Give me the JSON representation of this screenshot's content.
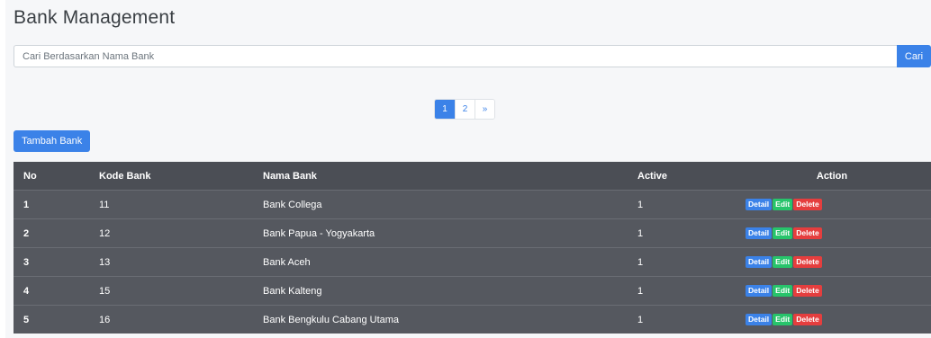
{
  "header": {
    "title": "Bank Management"
  },
  "search": {
    "placeholder": "Cari Berdasarkan Nama Bank",
    "value": "",
    "button_label": "Cari"
  },
  "pagination": {
    "pages": [
      "1",
      "2"
    ],
    "next_label": "»",
    "active_page": "1"
  },
  "toolbar": {
    "add_label": "Tambah Bank"
  },
  "colors": {
    "primary": "#3b82e8",
    "success": "#27c46b",
    "danger": "#e53e3e",
    "table_bg": "#55585f"
  },
  "table": {
    "columns": [
      "No",
      "Kode Bank",
      "Nama Bank",
      "Active",
      "Action"
    ],
    "action_labels": {
      "detail": "Detail",
      "edit": "Edit",
      "delete": "Delete"
    },
    "rows": [
      {
        "no": "1",
        "kode": "11",
        "nama": "Bank Collega",
        "active": "1"
      },
      {
        "no": "2",
        "kode": "12",
        "nama": "Bank Papua - Yogyakarta",
        "active": "1"
      },
      {
        "no": "3",
        "kode": "13",
        "nama": "Bank Aceh",
        "active": "1"
      },
      {
        "no": "4",
        "kode": "15",
        "nama": "Bank Kalteng",
        "active": "1"
      },
      {
        "no": "5",
        "kode": "16",
        "nama": "Bank Bengkulu Cabang Utama",
        "active": "1"
      }
    ]
  }
}
